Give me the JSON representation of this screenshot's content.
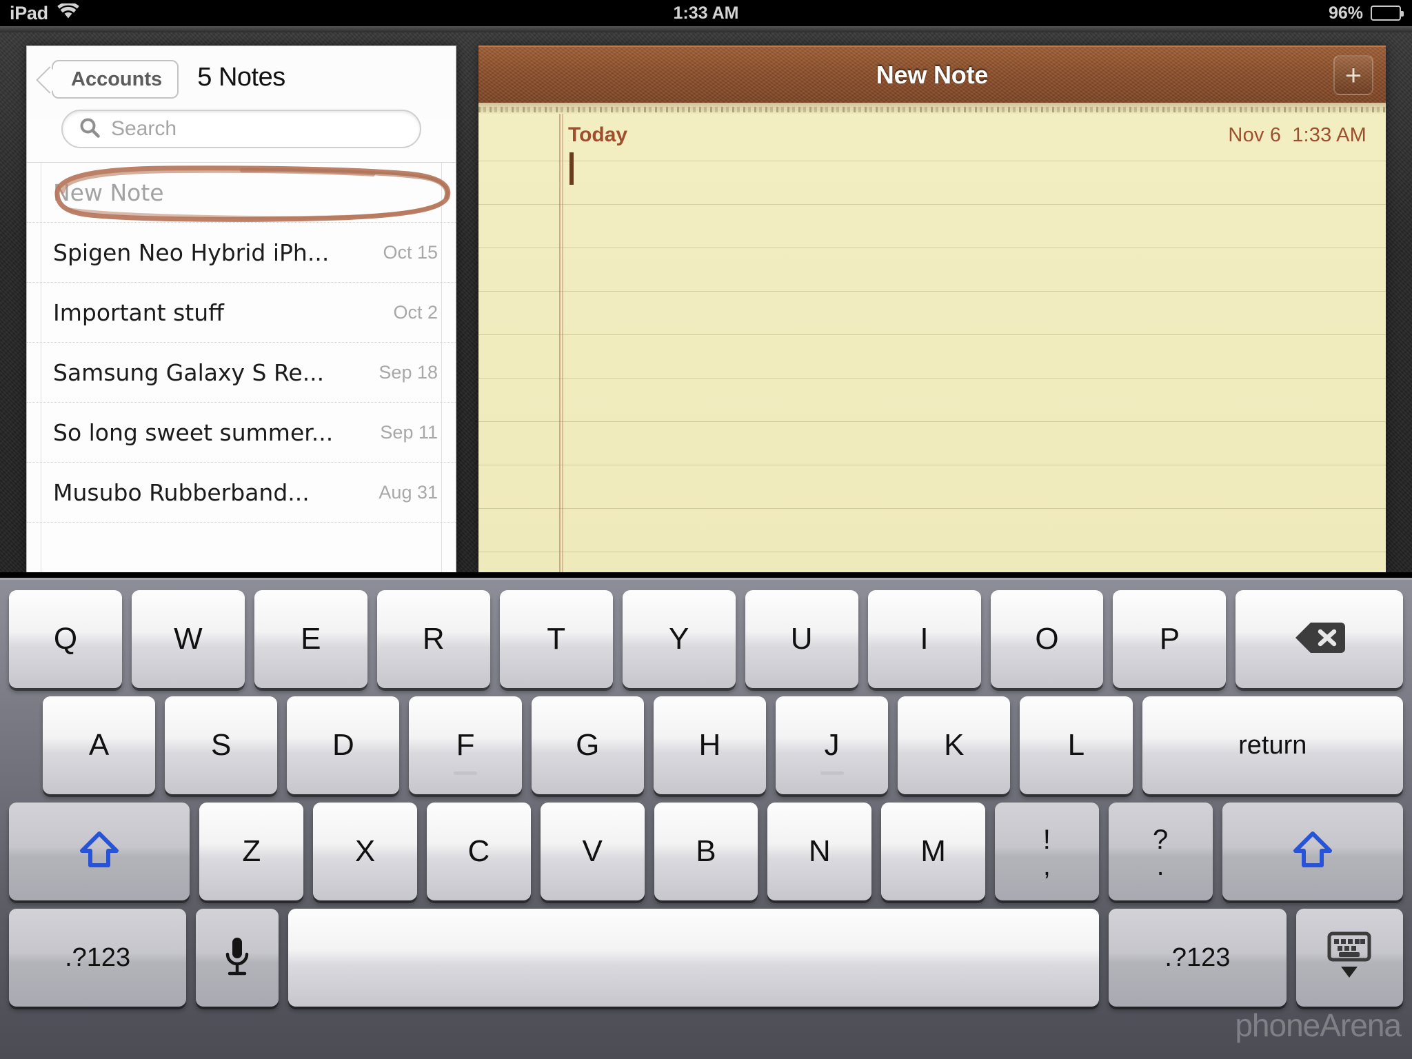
{
  "status_bar": {
    "device": "iPad",
    "wifi_icon": "wifi-icon",
    "time": "1:33 AM",
    "battery_percent": "96%",
    "battery_icon": "battery-icon"
  },
  "sidebar": {
    "back_button": "Accounts",
    "title": "5 Notes",
    "search": {
      "placeholder": "Search",
      "value": "",
      "icon": "search-icon"
    },
    "notes": [
      {
        "title": "New Note",
        "date": "",
        "selected": true
      },
      {
        "title": "Spigen Neo Hybrid iPh...",
        "date": "Oct 15",
        "selected": false
      },
      {
        "title": "Important stuff",
        "date": "Oct 2",
        "selected": false
      },
      {
        "title": "Samsung Galaxy S Re...",
        "date": "Sep 18",
        "selected": false
      },
      {
        "title": "So long sweet summer...",
        "date": "Sep 11",
        "selected": false
      },
      {
        "title": "Musubo Rubberband...",
        "date": "Aug 31",
        "selected": false
      }
    ],
    "annotation": {
      "type": "hand-drawn-circle",
      "target": "New Note",
      "color": "#b5755a"
    }
  },
  "detail": {
    "title": "New Note",
    "add_button_label": "+",
    "add_button_icon": "plus-icon",
    "day_label": "Today",
    "date": "Nov 6",
    "time": "1:33 AM",
    "body": "",
    "paper_color": "#f0ebbc",
    "header_color": "#8a4d28",
    "accent_color": "#9e4f2e"
  },
  "keyboard": {
    "layout": "qwerty-uppercase",
    "rows": [
      [
        {
          "label": "Q",
          "name": "key-q",
          "type": "char"
        },
        {
          "label": "W",
          "name": "key-w",
          "type": "char"
        },
        {
          "label": "E",
          "name": "key-e",
          "type": "char"
        },
        {
          "label": "R",
          "name": "key-r",
          "type": "char"
        },
        {
          "label": "T",
          "name": "key-t",
          "type": "char"
        },
        {
          "label": "Y",
          "name": "key-y",
          "type": "char"
        },
        {
          "label": "U",
          "name": "key-u",
          "type": "char"
        },
        {
          "label": "I",
          "name": "key-i",
          "type": "char"
        },
        {
          "label": "O",
          "name": "key-o",
          "type": "char"
        },
        {
          "label": "P",
          "name": "key-p",
          "type": "char"
        },
        {
          "label": "",
          "name": "backspace-key",
          "type": "backspace",
          "icon": "backspace-icon"
        }
      ],
      [
        {
          "label": "A",
          "name": "key-a",
          "type": "char"
        },
        {
          "label": "S",
          "name": "key-s",
          "type": "char"
        },
        {
          "label": "D",
          "name": "key-d",
          "type": "char"
        },
        {
          "label": "F",
          "name": "key-f",
          "type": "char",
          "home": true
        },
        {
          "label": "G",
          "name": "key-g",
          "type": "char"
        },
        {
          "label": "H",
          "name": "key-h",
          "type": "char"
        },
        {
          "label": "J",
          "name": "key-j",
          "type": "char",
          "home": true
        },
        {
          "label": "K",
          "name": "key-k",
          "type": "char"
        },
        {
          "label": "L",
          "name": "key-l",
          "type": "char"
        },
        {
          "label": "return",
          "name": "return-key",
          "type": "return"
        }
      ],
      [
        {
          "label": "",
          "name": "shift-key-left",
          "type": "shift",
          "icon": "shift-arrow-icon"
        },
        {
          "label": "Z",
          "name": "key-z",
          "type": "char"
        },
        {
          "label": "X",
          "name": "key-x",
          "type": "char"
        },
        {
          "label": "C",
          "name": "key-c",
          "type": "char"
        },
        {
          "label": "V",
          "name": "key-v",
          "type": "char"
        },
        {
          "label": "B",
          "name": "key-b",
          "type": "char"
        },
        {
          "label": "N",
          "name": "key-n",
          "type": "char"
        },
        {
          "label": "M",
          "name": "key-m",
          "type": "char"
        },
        {
          "top": "!",
          "bottom": ",",
          "name": "key-exclam-comma",
          "type": "dual"
        },
        {
          "top": "?",
          "bottom": ".",
          "name": "key-question-period",
          "type": "dual"
        },
        {
          "label": "",
          "name": "shift-key-right",
          "type": "shift",
          "icon": "shift-arrow-icon"
        }
      ],
      [
        {
          "label": ".?123",
          "name": "numeric-key-left",
          "type": "numeric"
        },
        {
          "label": "",
          "name": "dictation-key",
          "type": "mic",
          "icon": "microphone-icon"
        },
        {
          "label": "",
          "name": "space-key",
          "type": "space"
        },
        {
          "label": ".?123",
          "name": "numeric-key-right",
          "type": "numeric"
        },
        {
          "label": "",
          "name": "dismiss-keyboard-key",
          "type": "dismiss",
          "icon": "hide-keyboard-icon"
        }
      ]
    ]
  },
  "watermark": {
    "text": "phoneArena"
  }
}
